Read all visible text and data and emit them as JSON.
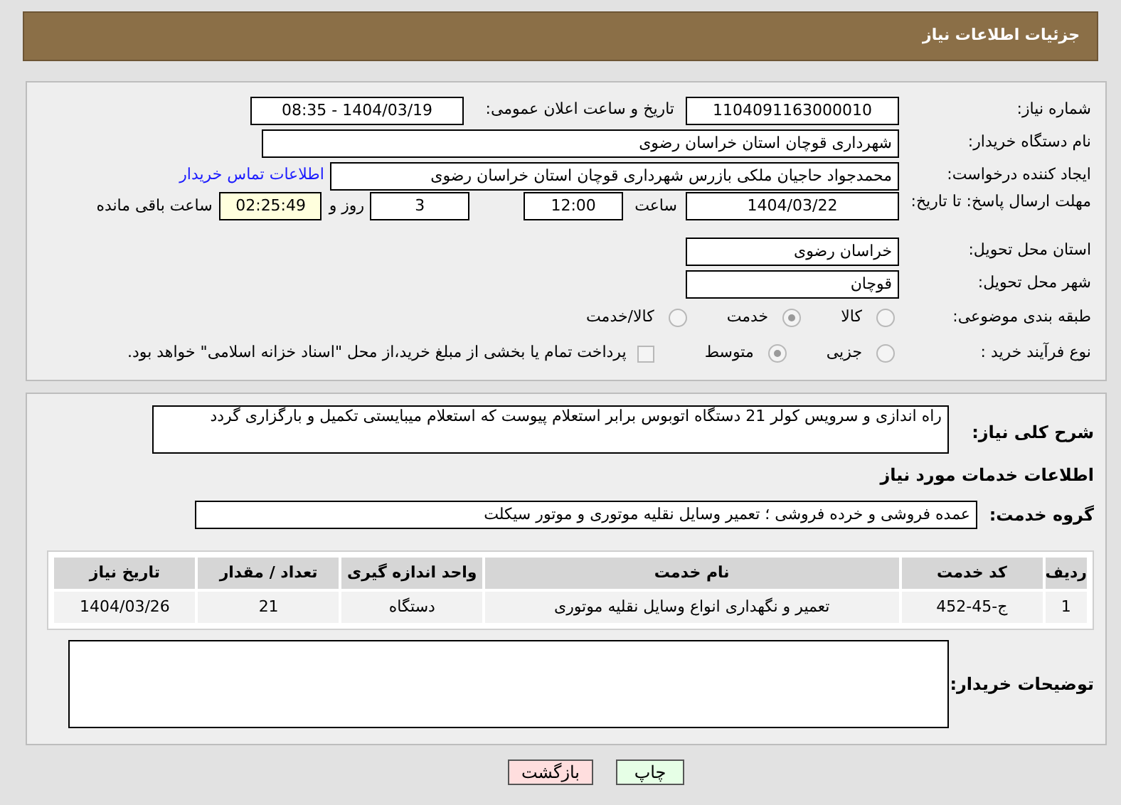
{
  "header": {
    "title": "جزئیات اطلاعات نیاز"
  },
  "need_number": {
    "label": "شماره نیاز:",
    "value": "1104091163000010"
  },
  "announce": {
    "label": "تاریخ و ساعت اعلان عمومی:",
    "value": "1404/03/19 - 08:35"
  },
  "buyer_org": {
    "label": "نام دستگاه خریدار:",
    "value": "شهرداری قوچان استان خراسان رضوی"
  },
  "requester": {
    "label": "ایجاد کننده درخواست:",
    "value": "محمدجواد حاجیان ملکی بازرس شهرداری قوچان استان خراسان رضوی",
    "link": "اطلاعات تماس خریدار"
  },
  "deadline": {
    "label": "مهلت ارسال پاسخ: تا تاریخ:",
    "date": "1404/03/22",
    "time_label": "ساعت",
    "time": "12:00",
    "days": "3",
    "days_label": "روز و",
    "remaining": "02:25:49",
    "remaining_label": "ساعت باقی مانده"
  },
  "province": {
    "label": "استان محل تحویل:",
    "value": "خراسان رضوی"
  },
  "city": {
    "label": "شهر محل تحویل:",
    "value": "قوچان"
  },
  "category": {
    "label": "طبقه بندی موضوعی:",
    "options": [
      {
        "label": "کالا",
        "selected": false
      },
      {
        "label": "خدمت",
        "selected": true
      },
      {
        "label": "کالا/خدمت",
        "selected": false
      }
    ]
  },
  "process": {
    "label": "نوع فرآیند خرید :",
    "options": [
      {
        "label": "جزیی",
        "selected": false
      },
      {
        "label": "متوسط",
        "selected": true
      }
    ],
    "payment_note": {
      "label": "پرداخت تمام یا بخشی از مبلغ خرید،از محل \"اسناد خزانه اسلامی\" خواهد بود.",
      "checked": false
    }
  },
  "description": {
    "label": "شرح کلی نیاز:",
    "value": "راه اندازی و سرویس کولر 21 دستگاه اتوبوس برابر استعلام پیوست که استعلام میبایستی تکمیل و بارگزاری گردد"
  },
  "services_heading": "اطلاعات خدمات مورد نیاز",
  "service_group": {
    "label": "گروه خدمت:",
    "value": "عمده فروشی و خرده فروشی ؛ تعمیر وسایل نقلیه موتوری و موتور سیکلت"
  },
  "table": {
    "columns": [
      "ردیف",
      "کد خدمت",
      "نام خدمت",
      "واحد اندازه گیری",
      "تعداد / مقدار",
      "تاریخ نیاز"
    ],
    "rows": [
      [
        "1",
        "ج-45-452",
        "تعمیر و نگهداری انواع وسایل نقلیه موتوری",
        "دستگاه",
        "21",
        "1404/03/26"
      ]
    ]
  },
  "buyer_notes": {
    "label": "توضیحات خریدار:"
  },
  "buttons": [
    {
      "label": "چاپ",
      "kind": "print"
    },
    {
      "label": "بازگشت",
      "kind": "back"
    }
  ]
}
